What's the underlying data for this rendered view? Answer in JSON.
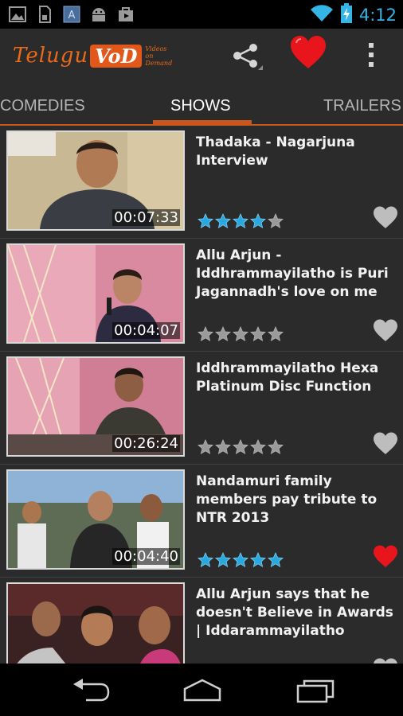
{
  "status_bar": {
    "time": "4:12",
    "icons": [
      "image-icon",
      "sd-card-icon",
      "app-icon",
      "android-icon",
      "store-bag-icon",
      "wifi-icon",
      "battery-charging-icon"
    ]
  },
  "app": {
    "logo_word": "Telugu",
    "logo_badge": "VoD",
    "logo_tagline": "Videos on Demand",
    "actions": [
      "share-icon",
      "favorites-heart-icon",
      "overflow-menu-icon"
    ]
  },
  "tabs": [
    {
      "label": "COMEDIES",
      "active": false
    },
    {
      "label": "SHOWS",
      "active": true
    },
    {
      "label": "TRAILERS",
      "active": false
    }
  ],
  "videos": [
    {
      "title": "Thadaka - Nagarjuna Interview",
      "duration": "00:07:33",
      "rating": 4,
      "favorite": false
    },
    {
      "title": "Allu Arjun - Iddhrammayilatho is Puri Jagannadh's love on me",
      "duration": "00:04:07",
      "rating": 0,
      "favorite": false
    },
    {
      "title": "Iddhrammayilatho Hexa Platinum Disc Function",
      "duration": "00:26:24",
      "rating": 0,
      "favorite": false
    },
    {
      "title": "Nandamuri family members pay tribute to NTR 2013",
      "duration": "00:04:40",
      "rating": 5,
      "favorite": true
    },
    {
      "title": "Allu Arjun says that he doesn't Believe in Awards | Iddarammayilatho",
      "duration": "",
      "rating": 0,
      "favorite": false
    }
  ],
  "colors": {
    "accent": "#c9561d",
    "star_on": "#29a8e0",
    "star_off": "#9a9a9a",
    "heart_on": "#e8151c",
    "heart_off": "#bdbdbd",
    "clock": "#33b5e5"
  },
  "nav": [
    "back-icon",
    "home-icon",
    "recent-apps-icon"
  ]
}
